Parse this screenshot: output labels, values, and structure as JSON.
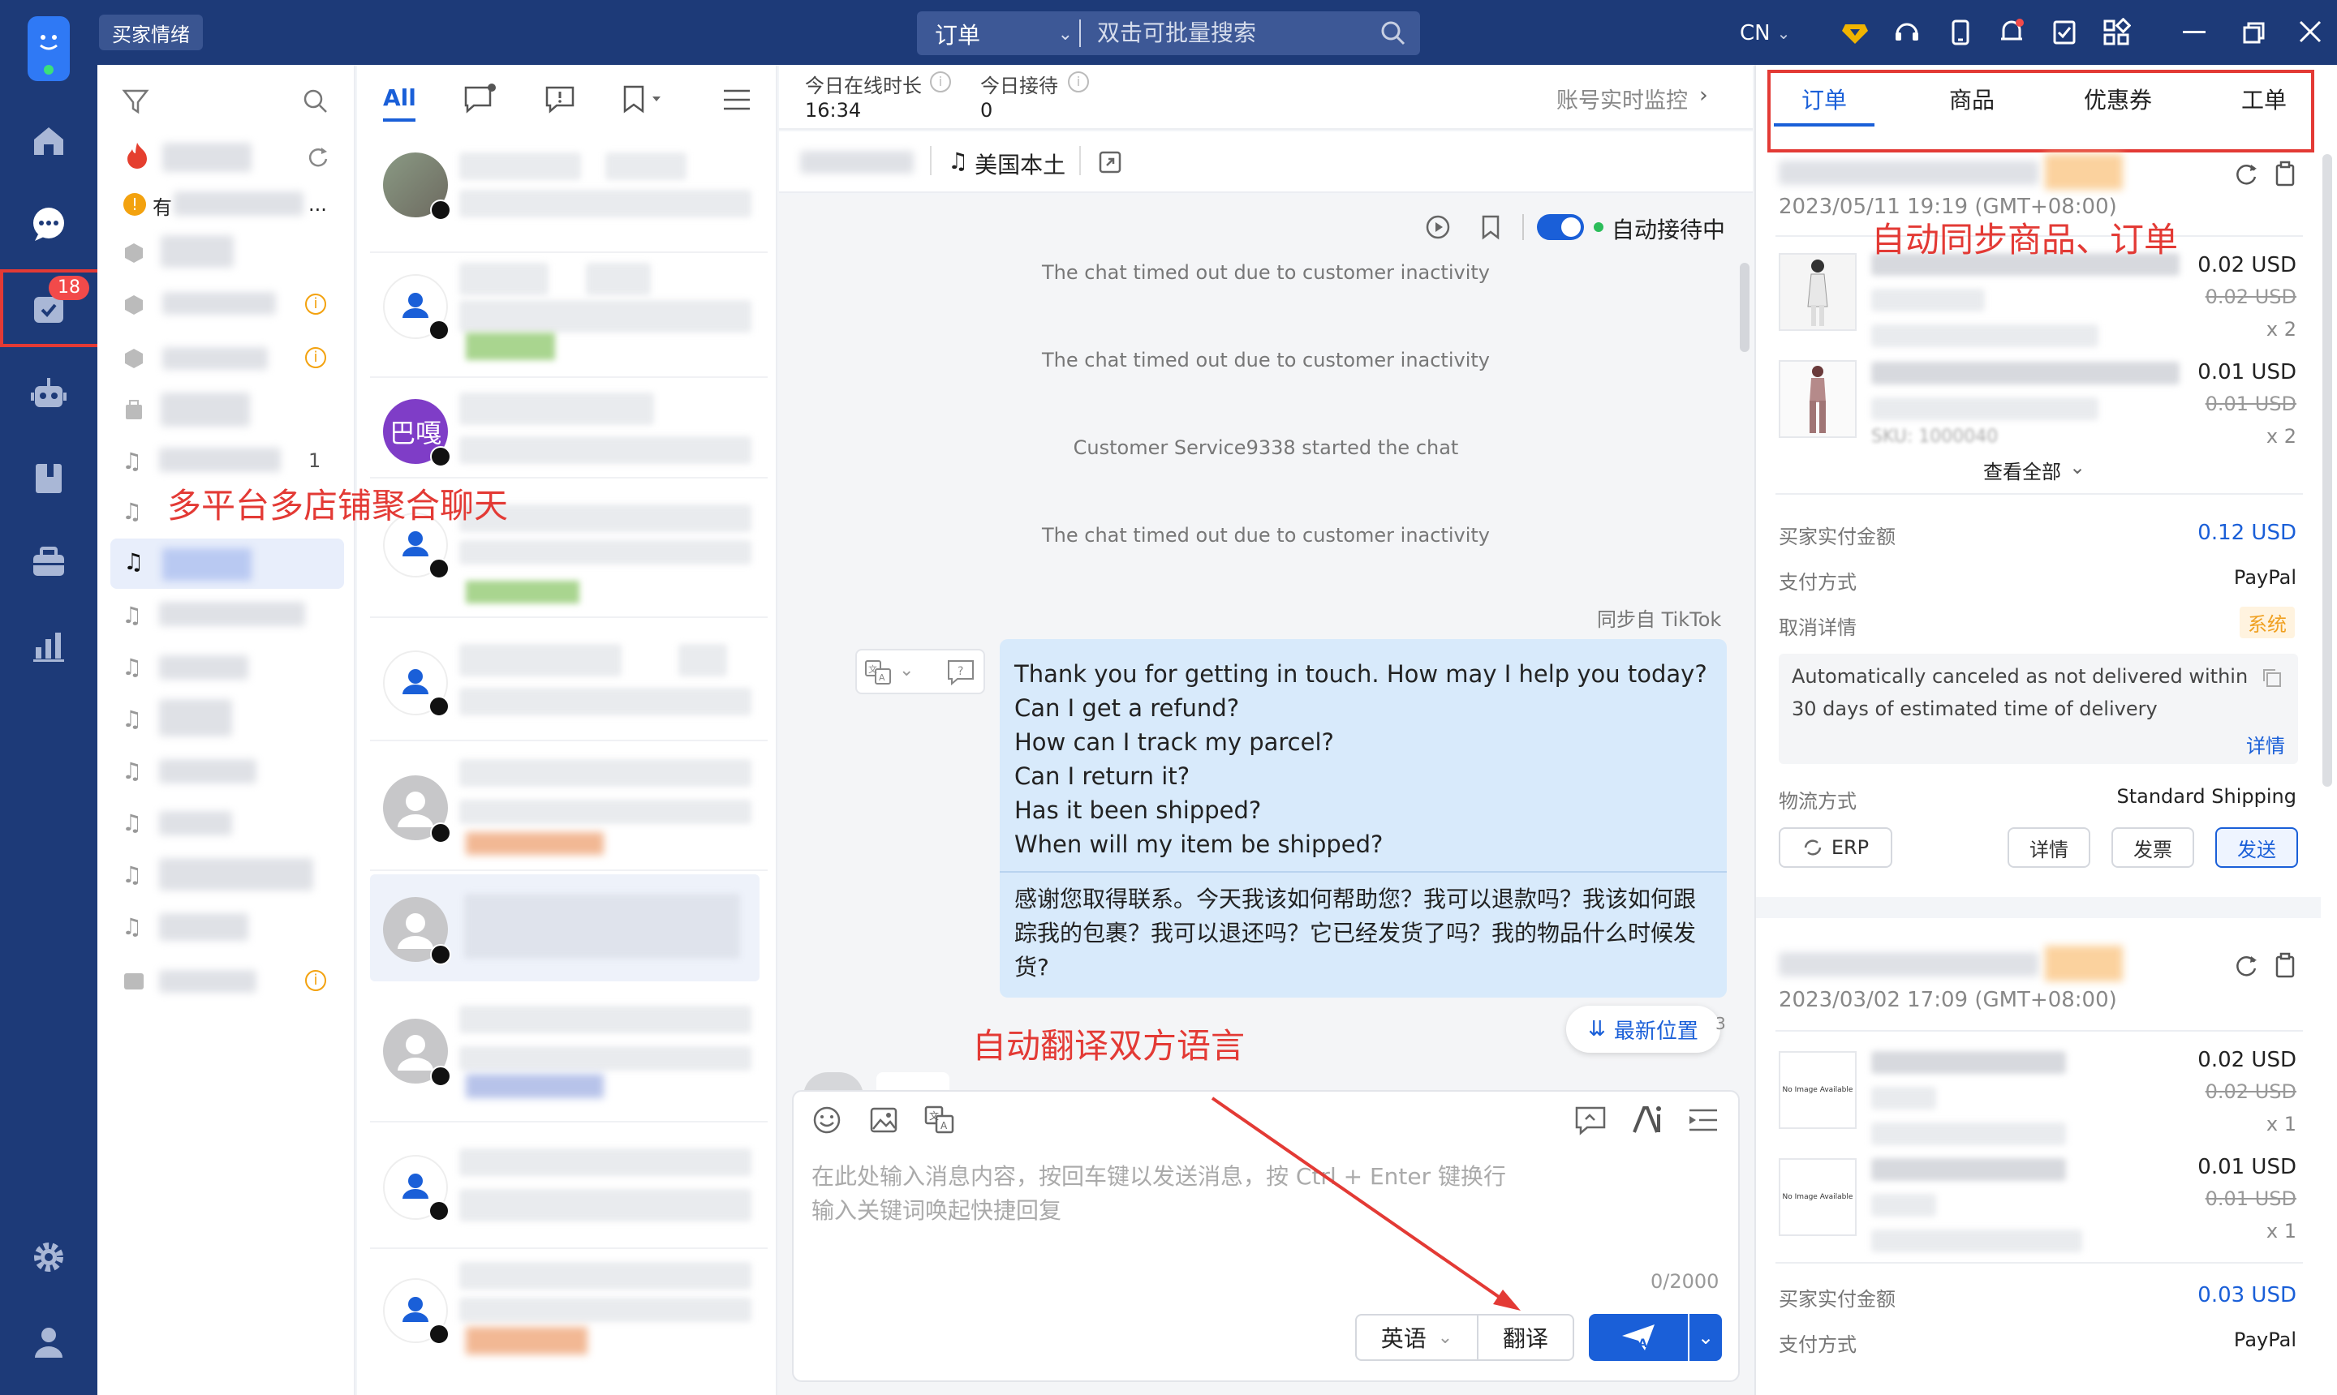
{
  "app": {
    "buyer_mood_tag": "买家情绪",
    "lang": "CN",
    "unread_badge": "18"
  },
  "search": {
    "scope": "订单",
    "placeholder": "双击可批量搜索"
  },
  "store_list": {
    "truncated_text": "有",
    "trailing_digit": "1",
    "dots": "..."
  },
  "chat_list": {
    "tab_all": "All",
    "avatar_text": "巴嘎"
  },
  "chat_header": {
    "online_label": "今日在线时长",
    "online_value": "16:34",
    "reception_label": "今日接待",
    "reception_value": "0",
    "monitor": "账号实时监控",
    "region": "美国本土",
    "auto_status": "自动接待中"
  },
  "messages": {
    "sys1": "The chat timed out due to customer inactivity",
    "sys2": "The chat timed out due to customer inactivity",
    "sys3": "Customer Service9338 started the chat",
    "sys4": "The chat timed out due to customer inactivity",
    "sync_from": "同步自 TikTok",
    "bubble_en": [
      "Thank you for getting in touch. How may I help you today?",
      "Can I get a refund?",
      "How can I track my parcel?",
      "Can I return it?",
      "Has it been shipped?",
      "When will my item be shipped?"
    ],
    "bubble_cn": "感谢您取得联系。今天我该如何帮助您？我可以退款吗？我该如何跟踪我的包裹？我可以退还吗？它已经发货了吗？我的物品什么时候发货?",
    "latest": "最新位置",
    "partial_digit": "3"
  },
  "composer": {
    "placeholder_line1": "在此处输入消息内容，按回车键以发送消息，按 Ctrl + Enter 键换行",
    "placeholder_line2": "输入关键词唤起快捷回复",
    "counter": "0/2000",
    "lang_select": "英语",
    "translate": "翻译"
  },
  "right_tabs": [
    "订单",
    "商品",
    "优惠券",
    "工单"
  ],
  "orders": [
    {
      "time": "2023/05/11 19:19 (GMT+08:00)",
      "items": [
        {
          "price": "0.02 USD",
          "orig": "0.02 USD",
          "qty": "x 2"
        },
        {
          "price": "0.01 USD",
          "orig": "0.01 USD",
          "qty": "x 2",
          "sku": "SKU: 1000040"
        }
      ],
      "view_all": "查看全部",
      "paid_label": "买家实付金额",
      "paid": "0.12 USD",
      "pay_label": "支付方式",
      "pay": "PayPal",
      "cancel_label": "取消详情",
      "cancel_tag": "系统",
      "cancel_text_1": "Automatically canceled as not delivered within",
      "cancel_text_2": "30 days of estimated time of delivery",
      "detail_link": "详情",
      "ship_label": "物流方式",
      "ship": "Standard Shipping",
      "buttons": [
        "ERP",
        "详情",
        "发票",
        "发送"
      ]
    },
    {
      "time": "2023/03/02 17:09 (GMT+08:00)",
      "items": [
        {
          "price": "0.02 USD",
          "orig": "0.02 USD",
          "qty": "x 1",
          "img": "No Image Available"
        },
        {
          "price": "0.01 USD",
          "orig": "0.01 USD",
          "qty": "x 1",
          "img": "No Image Available"
        }
      ],
      "paid_label": "买家实付金额",
      "paid": "0.03 USD",
      "pay_label": "支付方式",
      "pay": "PayPal"
    }
  ],
  "annotations": {
    "a1": "多平台多店铺聚合聊天",
    "a2": "自动同步商品、订单",
    "a3": "自动翻译双方语言"
  },
  "colors": {
    "nav": "#1d3a78",
    "accent": "#1a5fd8",
    "annotation": "#e33a35",
    "bubble": "#d8eafb"
  }
}
